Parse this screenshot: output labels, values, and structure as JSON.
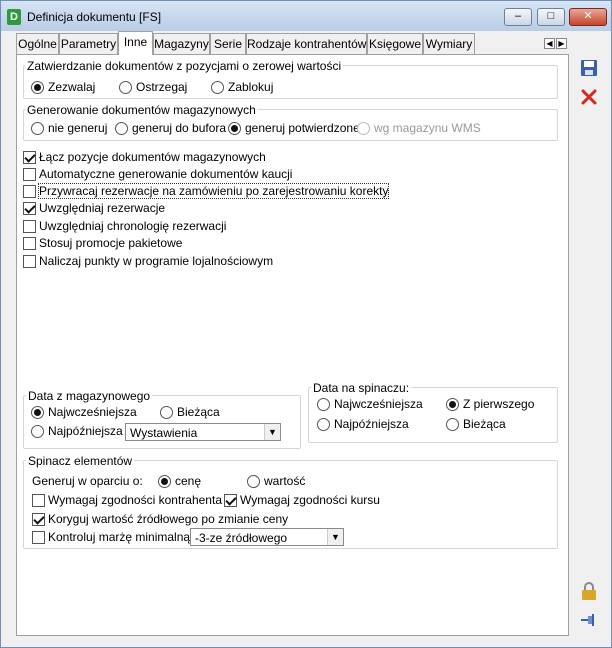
{
  "window": {
    "title": "Definicja dokumentu [FS]",
    "app_icon": "D"
  },
  "tabs": [
    "Ogólne",
    "Parametry",
    "Inne",
    "Magazyny",
    "Serie",
    "Rodzaje kontrahentów",
    "Księgowe",
    "Wymiary"
  ],
  "zatwierdzanie": {
    "title": "Zatwierdzanie dokumentów z pozycjami o zerowej wartości",
    "options": [
      "Zezwalaj",
      "Ostrzegaj",
      "Zablokuj"
    ],
    "selected": "Zezwalaj"
  },
  "generowanie": {
    "title": "Generowanie dokumentów magazynowych",
    "options": [
      "nie generuj",
      "generuj do bufora",
      "generuj potwierdzone",
      "wg magazynu WMS"
    ],
    "selected": "generuj potwierdzone"
  },
  "checkboxes": [
    {
      "label": "Łącz pozycje dokumentów magazynowych",
      "checked": true
    },
    {
      "label": "Automatyczne generowanie dokumentów kaucji",
      "checked": false
    },
    {
      "label": "Przywracaj rezerwacje na zamówieniu po zarejestrowaniu korekty",
      "checked": false
    },
    {
      "label": "Uwzględniaj rezerwacje",
      "checked": true
    },
    {
      "label": "Uwzględniaj chronologię rezerwacji",
      "checked": false
    },
    {
      "label": "Stosuj promocje pakietowe",
      "checked": false
    },
    {
      "label": "Naliczaj punkty w programie lojalnościowym",
      "checked": false
    }
  ],
  "data_z_mag": {
    "title": "Data z magazynowego",
    "opt1": "Najwcześniejsza",
    "opt2": "Bieżąca",
    "opt3": "Najpóźniejsza",
    "selected": "Najwcześniejsza",
    "select_value": "Wystawienia"
  },
  "data_spinacz": {
    "title": "Data na spinaczu:",
    "opt1": "Najwcześniejsza",
    "opt2": "Z pierwszego",
    "opt3": "Najpóźniejsza",
    "opt4": "Bieżąca",
    "selected": "Z pierwszego"
  },
  "spinacz": {
    "title": "Spinacz elementów",
    "generuj_label": "Generuj w oparciu o:",
    "opt_cena": "cenę",
    "opt_wartosc": "wartość",
    "selected": "cenę",
    "zgodnosc_kontrahenta": {
      "label": "Wymagaj zgodności kontrahenta",
      "checked": false
    },
    "zgodnosc_kursu": {
      "label": "Wymagaj zgodności kursu",
      "checked": true
    },
    "koryguj": {
      "label": "Koryguj wartość źródłowego po zmianie ceny",
      "checked": true
    },
    "marza": {
      "label": "Kontroluj marżę minimalną",
      "checked": false
    },
    "marza_select": "-3-ze źródłowego"
  },
  "colors": {
    "save_icon": "#3a5fb0",
    "delete_icon": "#d9261c",
    "lock_icon": "#d9a52a"
  }
}
